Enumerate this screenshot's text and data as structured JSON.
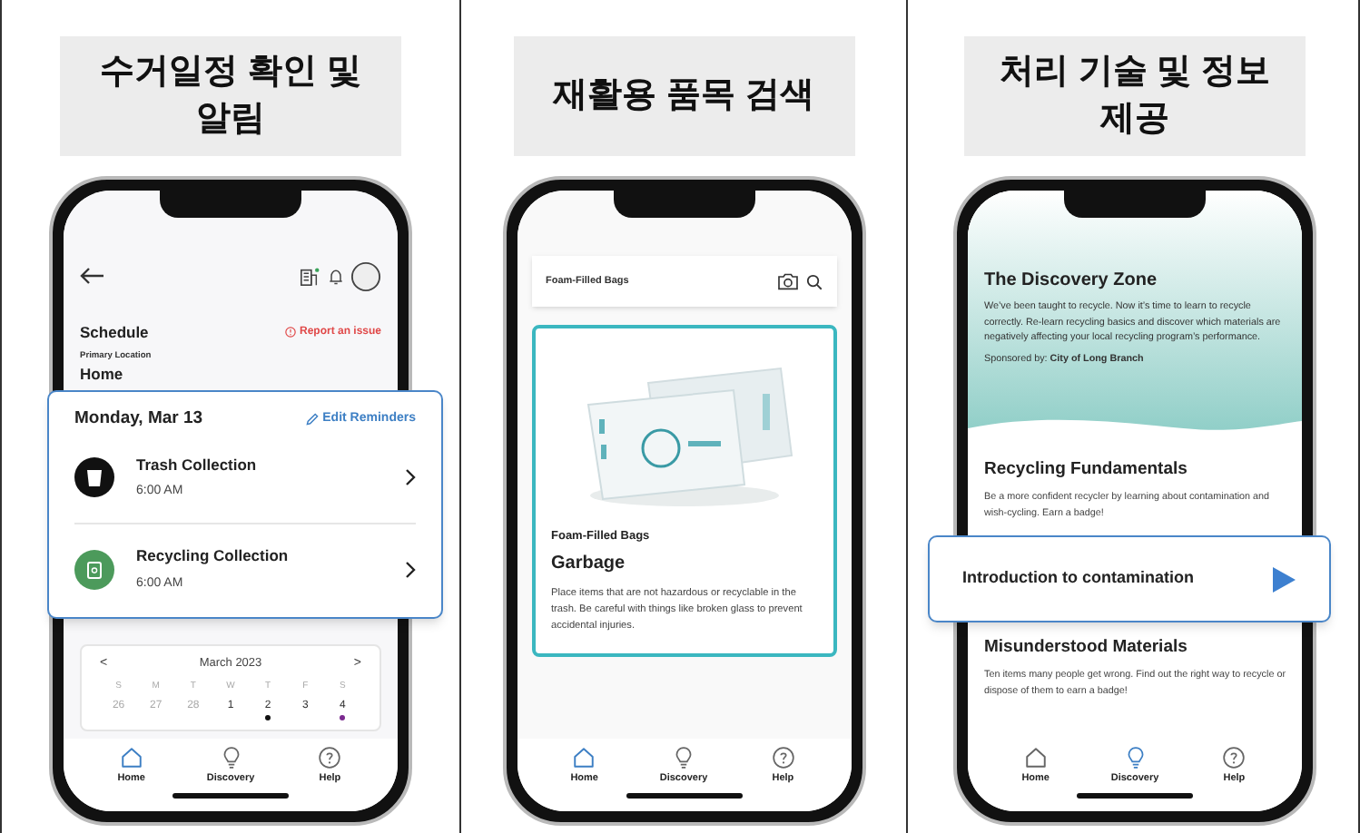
{
  "panels": [
    {
      "kind": "schedule",
      "title": "수거일정 확인 및 알림",
      "screen": {
        "section": "Schedule",
        "report_link": "Report an issue",
        "location_label": "Primary Location",
        "location": "Home",
        "reminder_card": {
          "date": "Monday, Mar 13",
          "edit_link": "Edit Reminders",
          "items": [
            {
              "kind": "trash",
              "title": "Trash Collection",
              "time": "6:00 AM"
            },
            {
              "kind": "recycling",
              "title": "Recycling Collection",
              "time": "6:00 AM"
            }
          ]
        },
        "calendar": {
          "prev": "<",
          "month": "March 2023",
          "next": ">",
          "weekdays": [
            "S",
            "M",
            "T",
            "W",
            "T",
            "F",
            "S"
          ],
          "days": [
            {
              "label": "26",
              "muted": true
            },
            {
              "label": "27",
              "muted": true
            },
            {
              "label": "28",
              "muted": true
            },
            {
              "label": "1",
              "muted": false
            },
            {
              "label": "2",
              "muted": false,
              "color": "#111111"
            },
            {
              "label": "3",
              "muted": false
            },
            {
              "label": "4",
              "muted": false,
              "color": "#7b2a8f"
            }
          ]
        }
      },
      "nav": [
        {
          "label": "Home",
          "selected": true
        },
        {
          "label": "Discovery",
          "selected": false
        },
        {
          "label": "Help",
          "selected": false
        }
      ]
    },
    {
      "kind": "search",
      "title": "재활용 품목 검색",
      "screen": {
        "query": "Foam-Filled Bags",
        "item": {
          "name": "Foam-Filled Bags",
          "category": "Garbage",
          "description": "Place items that are not hazardous or recyclable in the trash. Be careful with things like broken glass to prevent accidental injuries."
        }
      },
      "nav": [
        {
          "label": "Home",
          "selected": true
        },
        {
          "label": "Discovery",
          "selected": false
        },
        {
          "label": "Help",
          "selected": false
        }
      ]
    },
    {
      "kind": "discovery",
      "title": "처리 기술 및 정보 제공",
      "screen": {
        "heading": "The Discovery Zone",
        "intro": "We’ve been taught to recycle. Now it’s time to learn to recycle correctly. Re-learn recycling basics and discover which materials are negatively affecting your local recycling program’s performance.",
        "sponsor": "Sponsored by: **City of Long Branch**",
        "sections": [
          {
            "title": "Recycling Fundamentals",
            "description": "Be a more confident recycler by learning about contamination and wish-cycling. Earn a badge!"
          },
          {
            "title": "Misunderstood Materials",
            "description": "Ten items many people get wrong. Find out the right way to recycle or dispose of them to earn a badge!"
          }
        ],
        "lesson": "Introduction to contamination"
      },
      "nav": [
        {
          "label": "Home",
          "selected": false
        },
        {
          "label": "Discovery",
          "selected": true
        },
        {
          "label": "Help",
          "selected": false
        }
      ]
    }
  ]
}
